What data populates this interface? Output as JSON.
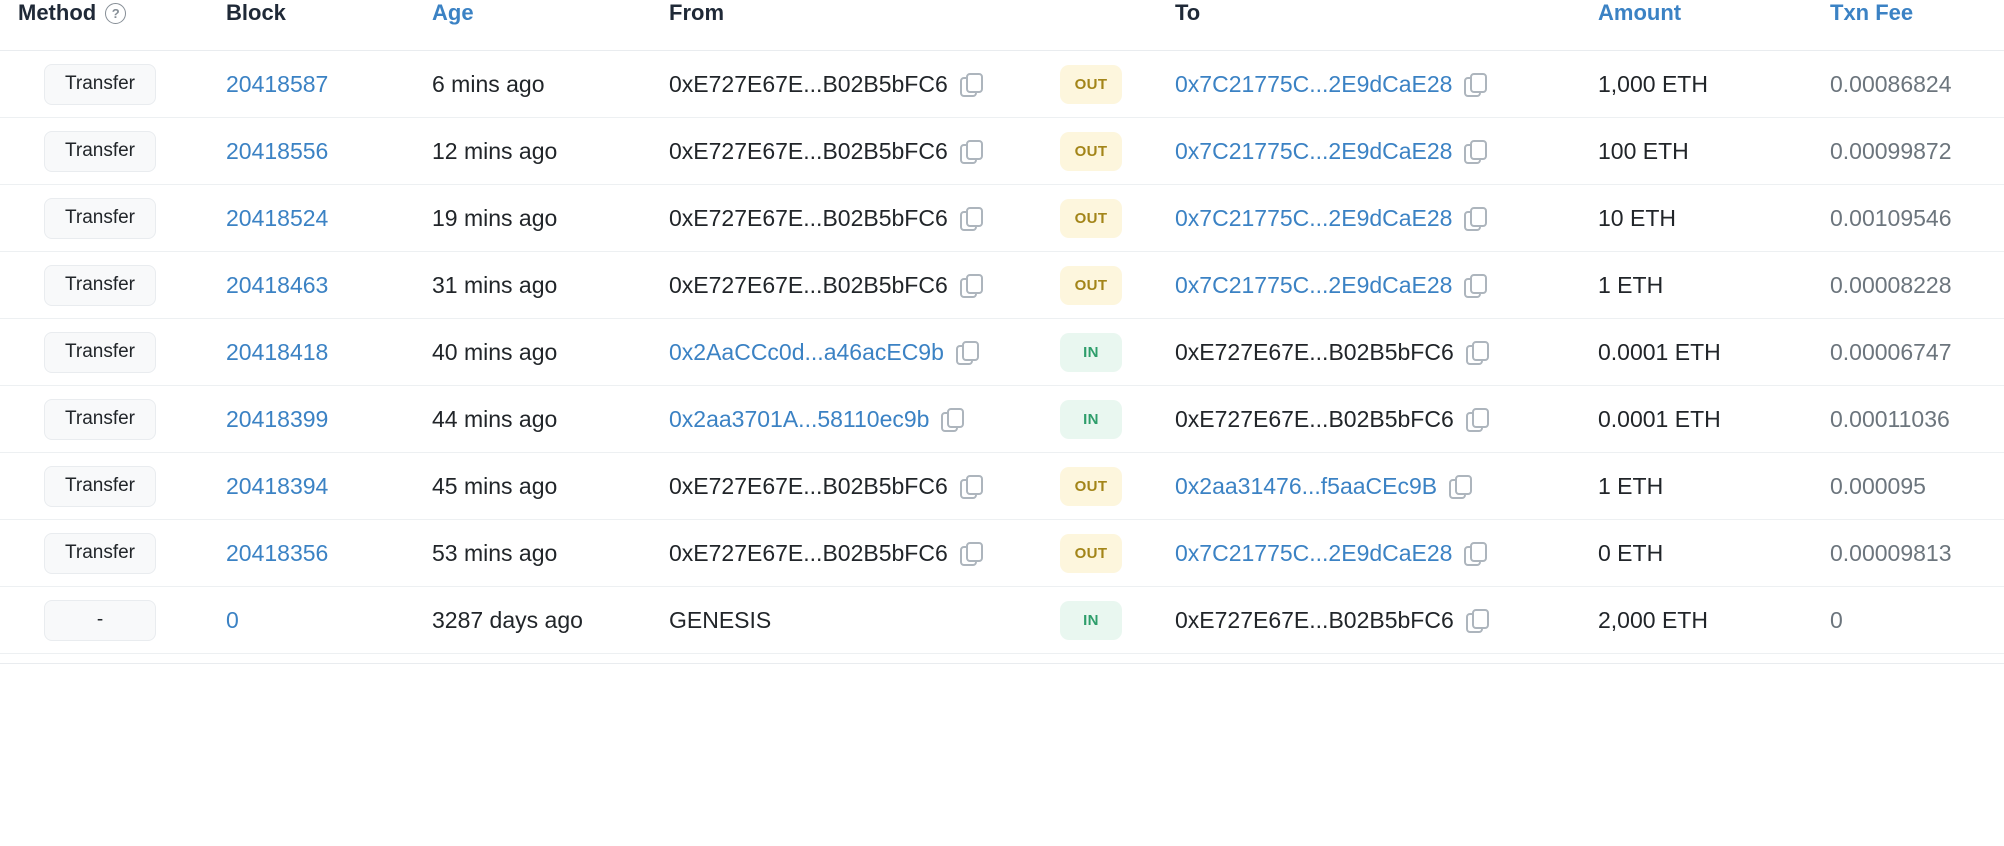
{
  "table": {
    "columns": [
      {
        "key": "method",
        "label": "Method",
        "sortable": false,
        "has_help_icon": true,
        "help_icon": "question-circle-icon"
      },
      {
        "key": "block",
        "label": "Block",
        "sortable": false
      },
      {
        "key": "age",
        "label": "Age",
        "sortable": true
      },
      {
        "key": "from",
        "label": "From",
        "sortable": false
      },
      {
        "key": "direction",
        "label": "",
        "sortable": false
      },
      {
        "key": "to",
        "label": "To",
        "sortable": false
      },
      {
        "key": "amount",
        "label": "Amount",
        "sortable": true
      },
      {
        "key": "fee",
        "label": "Txn Fee",
        "sortable": true
      }
    ],
    "colors": {
      "link": "#3b82c4",
      "out_badge_bg": "#fdf6dd",
      "out_badge_text": "#a38519",
      "in_badge_bg": "#e9f7f0",
      "in_badge_text": "#2e9e6b",
      "fee_text": "#6c757d",
      "pill_bg": "#f8f9fa",
      "row_border": "#edf0f2"
    },
    "copy_icon": "copy-icon",
    "rows": [
      {
        "method": "Transfer",
        "block": "20418587",
        "age": "6 mins ago",
        "from": "0xE727E67E...B02B5bFC6",
        "from_is_link": false,
        "from_has_copy": true,
        "direction": "OUT",
        "to": "0x7C21775C...2E9dCaE28",
        "to_is_link": true,
        "to_has_copy": true,
        "amount": "1,000 ETH",
        "fee": "0.00086824"
      },
      {
        "method": "Transfer",
        "block": "20418556",
        "age": "12 mins ago",
        "from": "0xE727E67E...B02B5bFC6",
        "from_is_link": false,
        "from_has_copy": true,
        "direction": "OUT",
        "to": "0x7C21775C...2E9dCaE28",
        "to_is_link": true,
        "to_has_copy": true,
        "amount": "100 ETH",
        "fee": "0.00099872"
      },
      {
        "method": "Transfer",
        "block": "20418524",
        "age": "19 mins ago",
        "from": "0xE727E67E...B02B5bFC6",
        "from_is_link": false,
        "from_has_copy": true,
        "direction": "OUT",
        "to": "0x7C21775C...2E9dCaE28",
        "to_is_link": true,
        "to_has_copy": true,
        "amount": "10 ETH",
        "fee": "0.00109546"
      },
      {
        "method": "Transfer",
        "block": "20418463",
        "age": "31 mins ago",
        "from": "0xE727E67E...B02B5bFC6",
        "from_is_link": false,
        "from_has_copy": true,
        "direction": "OUT",
        "to": "0x7C21775C...2E9dCaE28",
        "to_is_link": true,
        "to_has_copy": true,
        "amount": "1 ETH",
        "fee": "0.00008228"
      },
      {
        "method": "Transfer",
        "block": "20418418",
        "age": "40 mins ago",
        "from": "0x2AaCCc0d...a46acEC9b",
        "from_is_link": true,
        "from_has_copy": true,
        "direction": "IN",
        "to": "0xE727E67E...B02B5bFC6",
        "to_is_link": false,
        "to_has_copy": true,
        "amount": "0.0001 ETH",
        "fee": "0.00006747"
      },
      {
        "method": "Transfer",
        "block": "20418399",
        "age": "44 mins ago",
        "from": "0x2aa3701A...58110ec9b",
        "from_is_link": true,
        "from_has_copy": true,
        "direction": "IN",
        "to": "0xE727E67E...B02B5bFC6",
        "to_is_link": false,
        "to_has_copy": true,
        "amount": "0.0001 ETH",
        "fee": "0.00011036"
      },
      {
        "method": "Transfer",
        "block": "20418394",
        "age": "45 mins ago",
        "from": "0xE727E67E...B02B5bFC6",
        "from_is_link": false,
        "from_has_copy": true,
        "direction": "OUT",
        "to": "0x2aa31476...f5aaCEc9B",
        "to_is_link": true,
        "to_has_copy": true,
        "amount": "1 ETH",
        "fee": "0.000095"
      },
      {
        "method": "Transfer",
        "block": "20418356",
        "age": "53 mins ago",
        "from": "0xE727E67E...B02B5bFC6",
        "from_is_link": false,
        "from_has_copy": true,
        "direction": "OUT",
        "to": "0x7C21775C...2E9dCaE28",
        "to_is_link": true,
        "to_has_copy": true,
        "amount": "0 ETH",
        "fee": "0.00009813"
      },
      {
        "method": "-",
        "block": "0",
        "age": "3287 days ago",
        "from": "GENESIS",
        "from_is_link": false,
        "from_has_copy": false,
        "direction": "IN",
        "to": "0xE727E67E...B02B5bFC6",
        "to_is_link": false,
        "to_has_copy": true,
        "amount": "2,000 ETH",
        "fee": "0"
      }
    ]
  }
}
